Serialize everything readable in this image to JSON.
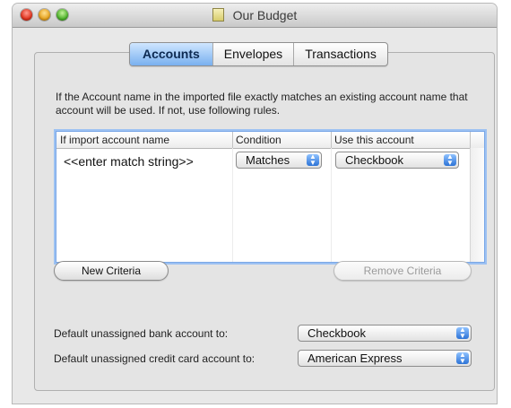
{
  "window": {
    "title": "Our Budget"
  },
  "tabs": [
    {
      "label": "Accounts",
      "active": true
    },
    {
      "label": "Envelopes",
      "active": false
    },
    {
      "label": "Transactions",
      "active": false
    }
  ],
  "help_text": "If the Account name in the imported file exactly matches an existing account name that account will be used.  If not, use following rules.",
  "rules_table": {
    "columns": [
      "If import account name",
      "Condition",
      "Use this account"
    ],
    "rows": [
      {
        "import_name": "<<enter match string>>",
        "condition": "Matches",
        "account": "Checkbook"
      }
    ]
  },
  "buttons": {
    "new_criteria": "New Criteria",
    "remove_criteria": "Remove Criteria"
  },
  "defaults": {
    "bank_label": "Default unassigned bank account to:",
    "bank_value": "Checkbook",
    "credit_label": "Default unassigned credit card account to:",
    "credit_value": "American Express"
  },
  "colors": {
    "accent": "#79b0ef",
    "close": "#e0341f",
    "minimize": "#e6a320",
    "zoom": "#4fb32c"
  }
}
